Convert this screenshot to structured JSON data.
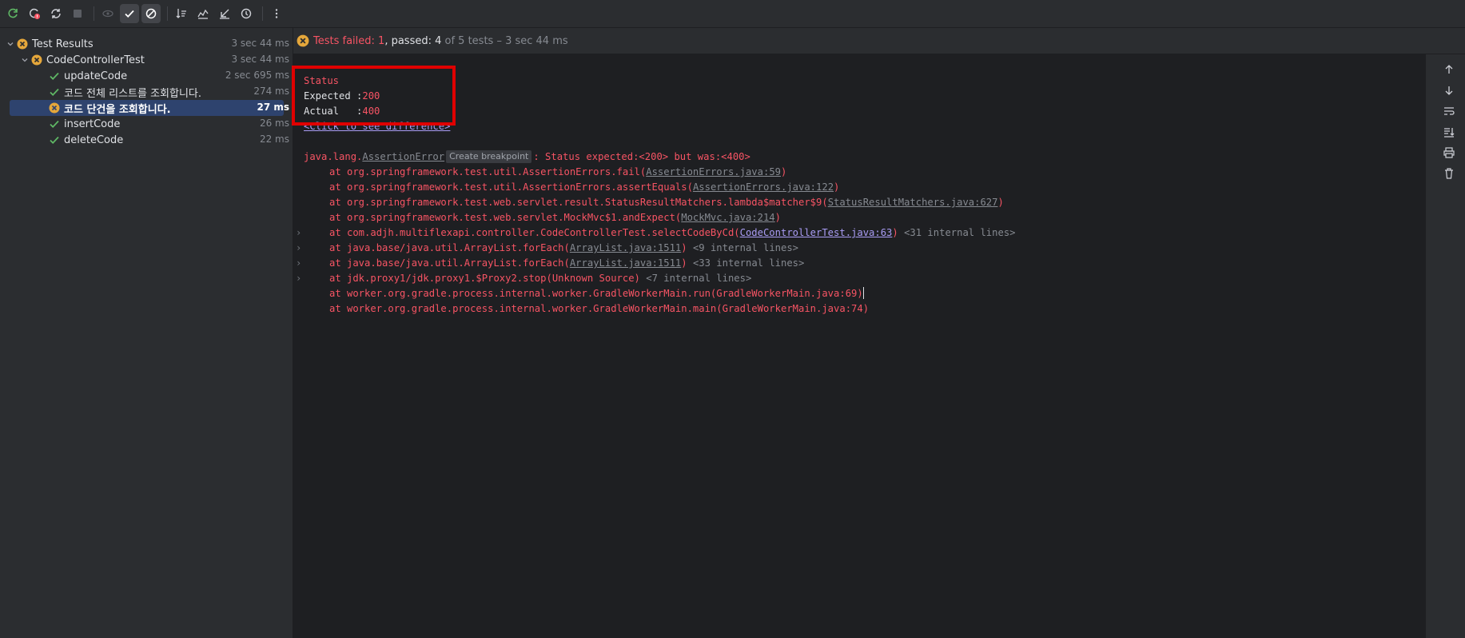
{
  "toolbar": {
    "buttons": [
      {
        "icon": "rerun-icon"
      },
      {
        "icon": "rerun-failed-icon"
      },
      {
        "icon": "toggle-auto-test-icon"
      },
      {
        "icon": "stop-icon"
      },
      {
        "icon": "show-ignored-icon"
      },
      {
        "icon": "show-passed-icon",
        "active": true
      },
      {
        "icon": "show-ignored-toggle-icon"
      },
      {
        "icon": "sort-alphabetically-icon"
      },
      {
        "icon": "sort-by-duration-icon"
      },
      {
        "icon": "import-tests-icon"
      },
      {
        "icon": "test-history-icon"
      },
      {
        "icon": "more-options-icon"
      }
    ]
  },
  "tree": {
    "root": {
      "label": "Test Results",
      "time": "3 sec 44 ms",
      "status": "failed"
    },
    "suite": {
      "label": "CodeControllerTest",
      "time": "3 sec 44 ms",
      "status": "failed"
    },
    "tests": [
      {
        "label": "updateCode",
        "time": "2 sec 695 ms",
        "status": "passed"
      },
      {
        "label": "코드 전체 리스트를 조회합니다.",
        "time": "274 ms",
        "status": "passed"
      },
      {
        "label": "코드 단건을 조회합니다.",
        "time": "27 ms",
        "status": "failed",
        "selected": true
      },
      {
        "label": "insertCode",
        "time": "26 ms",
        "status": "passed"
      },
      {
        "label": "deleteCode",
        "time": "22 ms",
        "status": "passed"
      }
    ]
  },
  "summary": {
    "failed_label": "Tests failed: 1",
    "passed_label": ", passed: 4",
    "rest_label": " of 5 tests – 3 sec 44 ms"
  },
  "console": {
    "status_title": "Status",
    "expected_label": "Expected :",
    "expected_value": "200",
    "actual_label": "Actual   :",
    "actual_value": "400",
    "diff_link": "<Click to see difference>",
    "error_prefix": "java.lang.",
    "error_class": "AssertionError",
    "tooltip": "Create breakpoint",
    "error_message": ": Status expected:<200> but was:<400>",
    "frames": [
      {
        "pre": "at org.springframework.test.util.AssertionErrors.fail(",
        "link": "AssertionErrors.java:59",
        "post": ")",
        "internal": "",
        "fold": false
      },
      {
        "pre": "at org.springframework.test.util.AssertionErrors.assertEquals(",
        "link": "AssertionErrors.java:122",
        "post": ")",
        "internal": "",
        "fold": false
      },
      {
        "pre": "at org.springframework.test.web.servlet.result.StatusResultMatchers.lambda$matcher$9(",
        "link": "StatusResultMatchers.java:627",
        "post": ")",
        "internal": "",
        "fold": false
      },
      {
        "pre": "at org.springframework.test.web.servlet.MockMvc$1.andExpect(",
        "link": "MockMvc.java:214",
        "post": ")",
        "internal": "",
        "fold": false
      },
      {
        "pre": "at com.adjh.multiflexapi.controller.CodeControllerTest.selectCodeByCd(",
        "link": "CodeControllerTest.java:63",
        "post": ")",
        "internal": " <31 internal lines>",
        "fold": true,
        "bright": true
      },
      {
        "pre": "at java.base/java.util.ArrayList.forEach(",
        "link": "ArrayList.java:1511",
        "post": ")",
        "internal": " <9 internal lines>",
        "fold": true
      },
      {
        "pre": "at java.base/java.util.ArrayList.forEach(",
        "link": "ArrayList.java:1511",
        "post": ")",
        "internal": " <33 internal lines>",
        "fold": true
      },
      {
        "pre": "at jdk.proxy1/jdk.proxy1.$Proxy2.stop(Unknown Source)",
        "link": "",
        "post": "",
        "internal": " <7 internal lines>",
        "fold": true
      },
      {
        "pre": "at worker.org.gradle.process.internal.worker.GradleWorkerMain.run(GradleWorkerMain.java:69)",
        "link": "",
        "post": "",
        "internal": "",
        "fold": false,
        "caret": true
      },
      {
        "pre": "at worker.org.gradle.process.internal.worker.GradleWorkerMain.main(GradleWorkerMain.java:74)",
        "link": "",
        "post": "",
        "internal": "",
        "fold": false
      }
    ]
  },
  "side_tools": [
    {
      "icon": "arrow-up-icon"
    },
    {
      "icon": "arrow-down-icon"
    },
    {
      "icon": "soft-wrap-icon"
    },
    {
      "icon": "scroll-to-end-icon"
    },
    {
      "icon": "print-icon"
    },
    {
      "icon": "clear-all-icon"
    }
  ],
  "colors": {
    "fail": "#f75464",
    "pass": "#5fb865",
    "warn": "#e5a73b",
    "selection": "#2e436e",
    "highlight_box": "#e00000"
  }
}
